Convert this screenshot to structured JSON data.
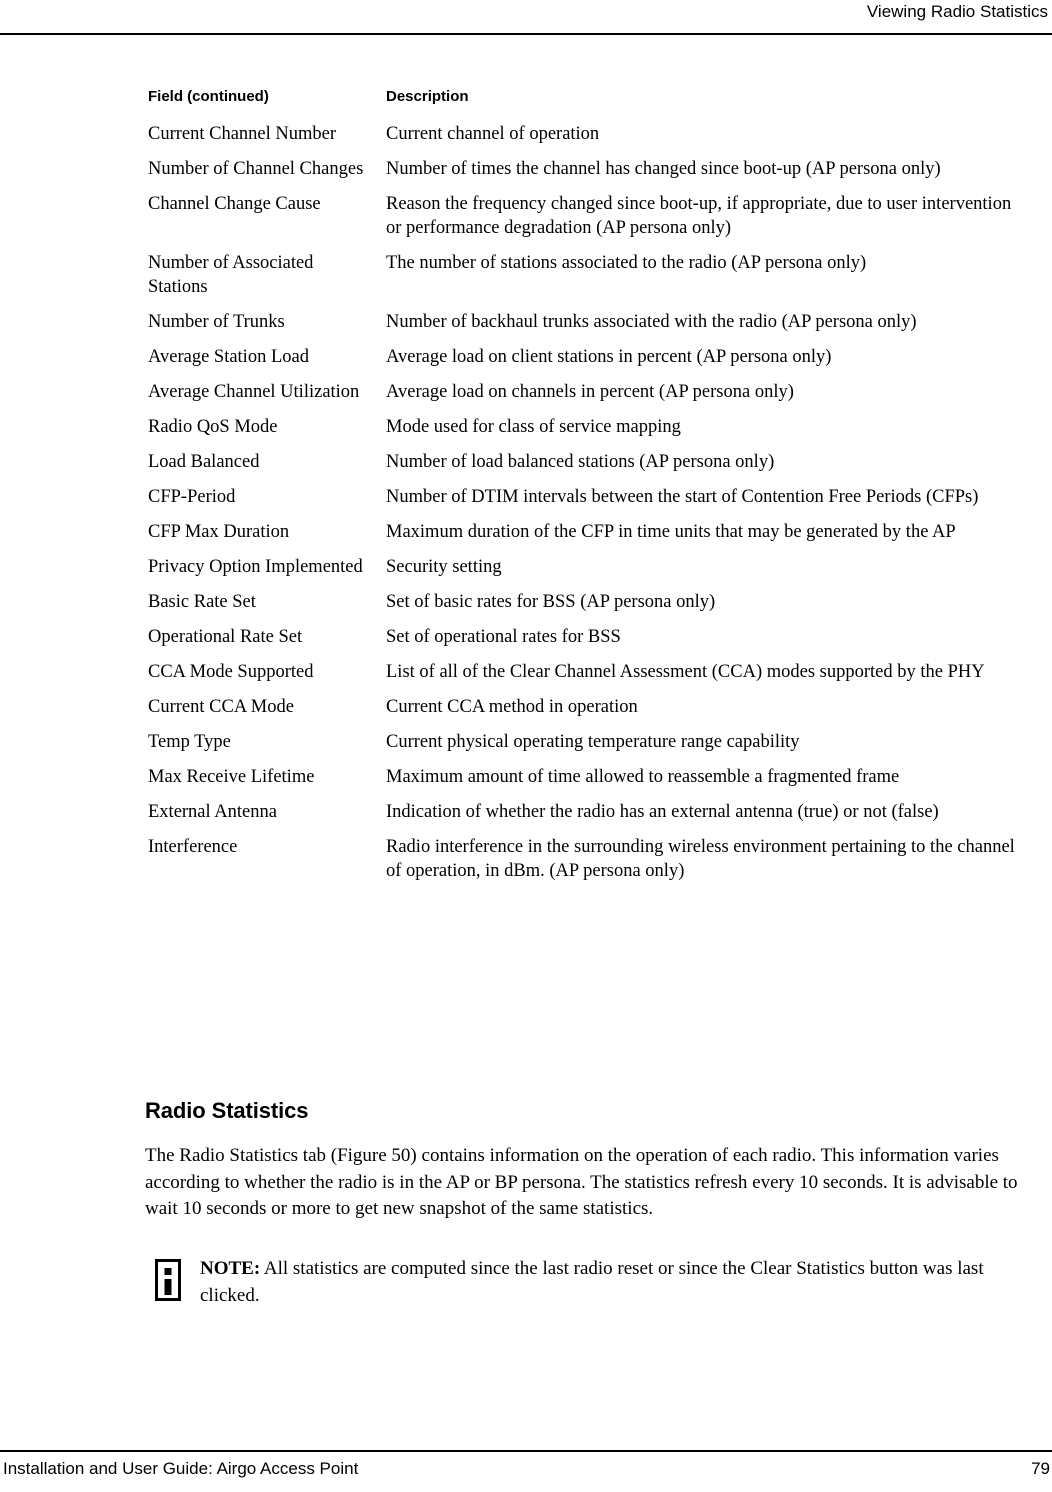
{
  "header": {
    "title": "Viewing Radio Statistics"
  },
  "table": {
    "columns": [
      "Field  (continued)",
      "Description"
    ],
    "rows": [
      {
        "field": "Current Channel Number",
        "description": "Current channel of operation"
      },
      {
        "field": "Number of Channel Changes",
        "description": "Number of times the channel has changed since boot-up (AP persona only)"
      },
      {
        "field": "Channel Change Cause",
        "description": "Reason the frequency changed since boot-up, if appropriate, due to user intervention or performance degradation (AP persona only)"
      },
      {
        "field": "Number of Associated Stations",
        "description": "The number of stations associated to the radio (AP persona only)"
      },
      {
        "field": "Number of Trunks",
        "description": "Number of backhaul trunks associated with the radio (AP persona only)"
      },
      {
        "field": "Average Station Load",
        "description": "Average load on client stations in percent (AP persona only)"
      },
      {
        "field": "Average Channel Utilization",
        "description": "Average load on channels in percent (AP persona only)"
      },
      {
        "field": "Radio QoS Mode",
        "description": "Mode used for class of service mapping"
      },
      {
        "field": "Load Balanced",
        "description": "Number of load balanced stations (AP persona only)"
      },
      {
        "field": "CFP-Period",
        "description": "Number of DTIM intervals between the start of Contention Free Periods (CFPs)"
      },
      {
        "field": "CFP Max Duration",
        "description": "Maximum duration of the CFP in time units that may be generated by the AP"
      },
      {
        "field": "Privacy Option Implemented",
        "description": "Security setting"
      },
      {
        "field": "Basic Rate Set",
        "description": "Set of basic rates for BSS (AP persona only)"
      },
      {
        "field": "Operational Rate Set",
        "description": "Set of operational rates for BSS"
      },
      {
        "field": "CCA Mode Supported",
        "description": "List of all of the Clear Channel Assessment (CCA) modes supported by the PHY"
      },
      {
        "field": "Current CCA Mode",
        "description": "Current CCA method in operation"
      },
      {
        "field": "Temp Type",
        "description": "Current physical operating temperature range capability"
      },
      {
        "field": "Max Receive Lifetime",
        "description": "Maximum amount of time allowed to reassemble a fragmented frame"
      },
      {
        "field": "External Antenna",
        "description": "Indication of whether the radio has an external antenna (true) or not (false)"
      },
      {
        "field": "Interference",
        "description": "Radio interference in the surrounding wireless environment pertaining to the channel of operation, in dBm. (AP persona only)"
      }
    ]
  },
  "section": {
    "heading": "Radio Statistics",
    "paragraph": "The Radio Statistics tab (Figure 50) contains information on the operation of each radio. This information varies according to whether the radio is in the AP or BP persona. The statistics refresh every 10 seconds. It is advisable to wait 10 seconds or more to get new snapshot of the same statistics."
  },
  "note": {
    "label": "NOTE:",
    "text": " All statistics are computed since the last radio reset or since the Clear Statistics button was last clicked.",
    "icon": "info-icon"
  },
  "footer": {
    "title": "Installation and User Guide: Airgo Access Point",
    "page_number": "79"
  }
}
